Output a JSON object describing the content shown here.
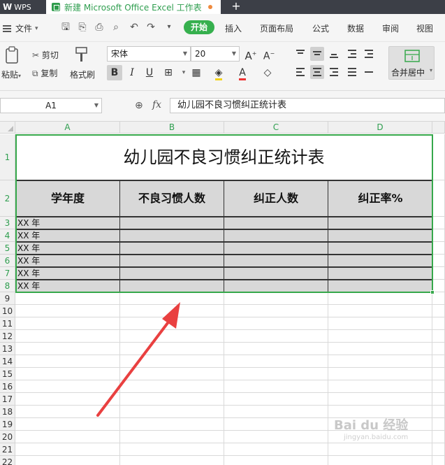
{
  "tabs": {
    "app": "WPS",
    "file": "新建 Microsoft Office Excel 工作表"
  },
  "menu": {
    "file": "文件",
    "items": [
      "开始",
      "插入",
      "页面布局",
      "公式",
      "数据",
      "审阅",
      "视图"
    ]
  },
  "ribbon": {
    "paste": "粘贴",
    "cut": "剪切",
    "copy": "复制",
    "format_painter": "格式刷",
    "font_name": "宋体",
    "font_size": "20",
    "bold": "B",
    "italic": "I",
    "underline": "U",
    "merge_center": "合并居中"
  },
  "formula_bar": {
    "name_box": "A1",
    "fx": "fx",
    "formula": "幼儿园不良习惯纠正统计表"
  },
  "sheet": {
    "columns": [
      "A",
      "B",
      "C",
      "D"
    ],
    "rows": [
      "1",
      "2",
      "3",
      "4",
      "5",
      "6",
      "7",
      "8",
      "9",
      "10",
      "11",
      "12",
      "13",
      "14",
      "15",
      "16",
      "17",
      "18",
      "19",
      "20",
      "21",
      "22"
    ],
    "title": "幼儿园不良习惯纠正统计表",
    "headers": [
      "学年度",
      "不良习惯人数",
      "纠正人数",
      "纠正率%"
    ],
    "data_rows": [
      "XX 年",
      "XX 年",
      "XX 年",
      "XX 年",
      "XX 年",
      "XX 年"
    ]
  },
  "watermark": {
    "text": "Bai du 经验",
    "sub": "jingyan.baidu.com"
  },
  "colors": {
    "accent": "#36b04e",
    "header_fill": "#d8d8d8",
    "arrow": "#e94040"
  }
}
